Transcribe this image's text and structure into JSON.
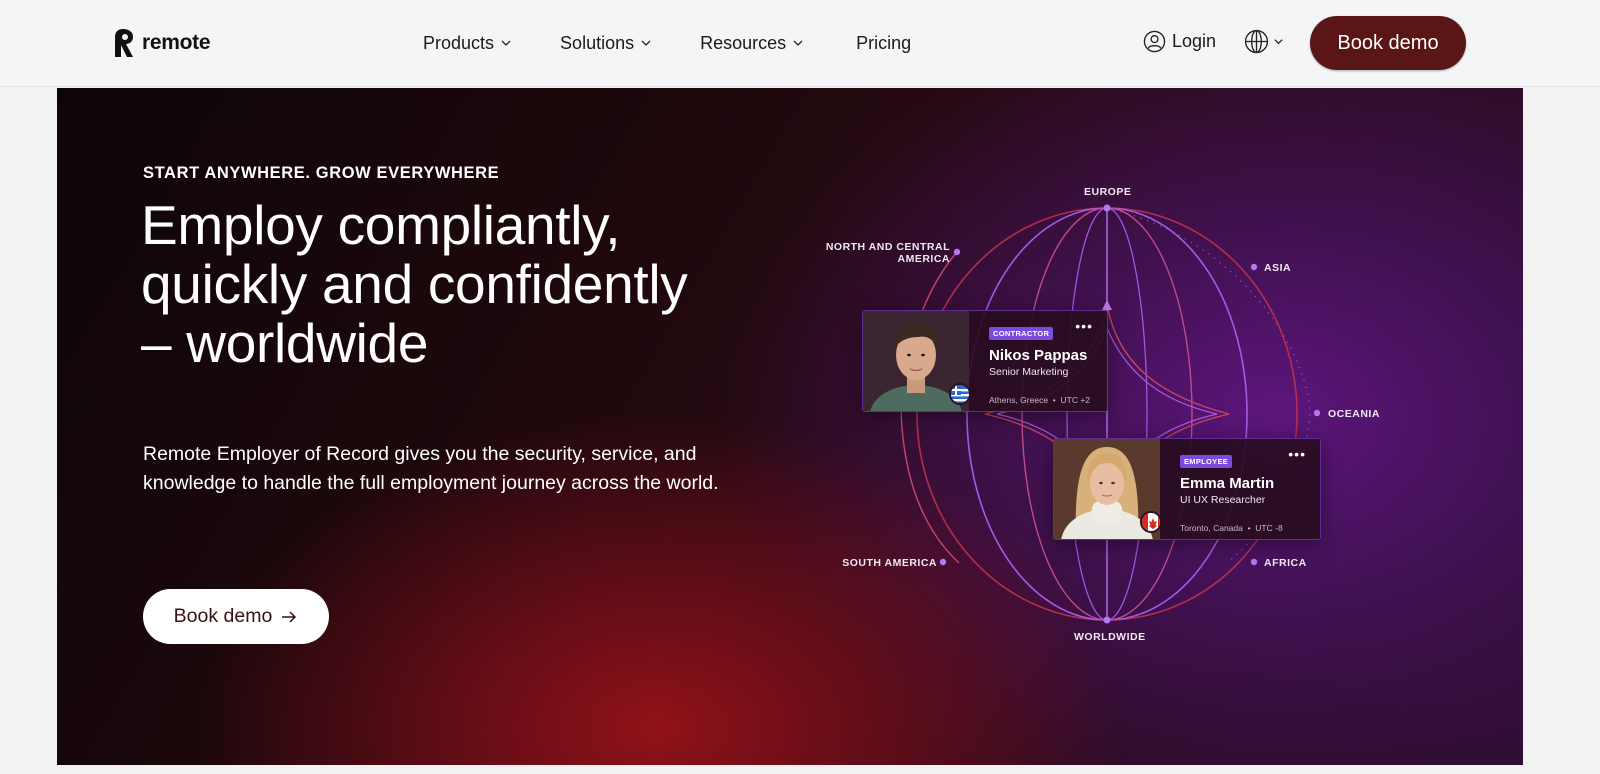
{
  "header": {
    "logo_text": "remote",
    "nav": [
      {
        "label": "Products",
        "has_dropdown": true
      },
      {
        "label": "Solutions",
        "has_dropdown": true
      },
      {
        "label": "Resources",
        "has_dropdown": true
      },
      {
        "label": "Pricing",
        "has_dropdown": false
      }
    ],
    "login_label": "Login",
    "language_icon": "globe-icon",
    "book_demo_label": "Book demo"
  },
  "hero": {
    "eyebrow": "START ANYWHERE. GROW EVERYWHERE",
    "headline": "Employ compliantly, quickly and confidently – worldwide",
    "subtext": "Remote Employer of Record gives you the security, service, and knowledge to handle the full employment journey across the world.",
    "cta_label": "Book demo"
  },
  "globe": {
    "regions": {
      "europe": "EUROPE",
      "north_central_america": "NORTH AND CENTRAL AMERICA",
      "asia": "ASIA",
      "oceania": "OCEANIA",
      "south_america": "SOUTH AMERICA",
      "africa": "AFRICA",
      "worldwide": "WORLDWIDE"
    },
    "cards": [
      {
        "badge": "CONTRACTOR",
        "name": "Nikos Pappas",
        "role": "Senior Marketing",
        "city": "Athens, Greece",
        "tz": "UTC +2",
        "flag": "greece"
      },
      {
        "badge": "EMPLOYEE",
        "name": "Emma Martin",
        "role": "UI UX Researcher",
        "city": "Toronto, Canada",
        "tz": "UTC -8",
        "flag": "canada"
      }
    ]
  },
  "colors": {
    "brand_dark": "#5a1616",
    "accent_purple": "#7b4bdc",
    "header_bg": "#f4f5f6"
  }
}
